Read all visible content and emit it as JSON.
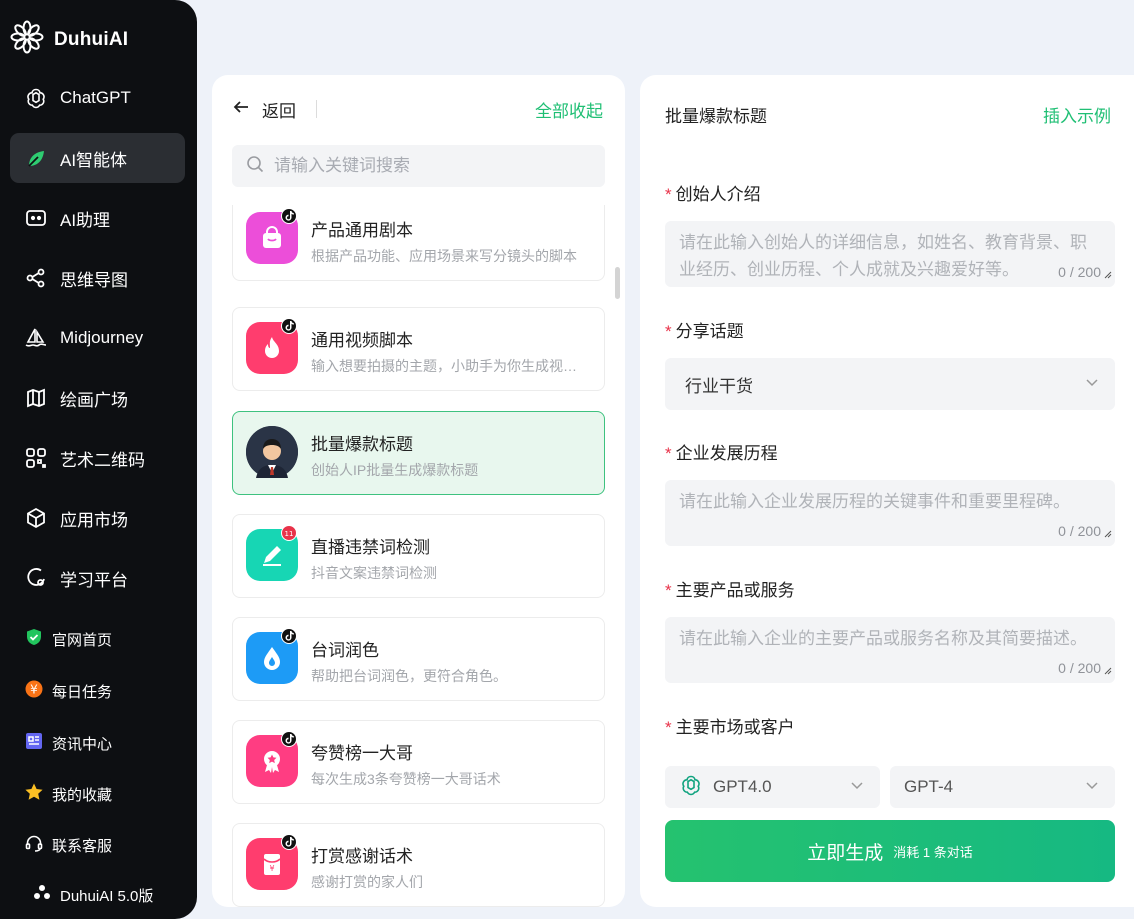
{
  "brand": {
    "name": "DuhuiAI"
  },
  "nav": [
    {
      "label": "ChatGPT",
      "icon": "openai-icon"
    },
    {
      "label": "AI智能体",
      "icon": "leaf-agent-icon",
      "active": true
    },
    {
      "label": "AI助理",
      "icon": "robot-face-icon"
    },
    {
      "label": "思维导图",
      "icon": "mindmap-icon"
    },
    {
      "label": "Midjourney",
      "icon": "sailboat-icon"
    },
    {
      "label": "绘画广场",
      "icon": "map-book-icon"
    },
    {
      "label": "艺术二维码",
      "icon": "qrcode-icon"
    },
    {
      "label": "应用市场",
      "icon": "cube-icon"
    },
    {
      "label": "学习平台",
      "icon": "learning-icon"
    }
  ],
  "subnav": [
    {
      "label": "官网首页",
      "icon": "shield-check-icon"
    },
    {
      "label": "每日任务",
      "icon": "coin-task-icon"
    },
    {
      "label": "资讯中心",
      "icon": "news-icon"
    },
    {
      "label": "我的收藏",
      "icon": "star-icon"
    },
    {
      "label": "联系客服",
      "icon": "headset-icon"
    }
  ],
  "version": "DuhuiAI 5.0版",
  "middle": {
    "back_label": "返回",
    "collapse_label": "全部收起",
    "search_placeholder": "请输入关键词搜索",
    "cards": [
      {
        "title": "产品通用剧本",
        "desc": "根据产品功能、应用场景来写分镜头的脚本",
        "color": "#ec4ed9",
        "icon": "shopping-bag-icon",
        "badge": "tiktok"
      },
      {
        "title": "通用视频脚本",
        "desc": "输入想要拍摄的主题，小助手为你生成视频脚本",
        "color": "#ff3d6e",
        "icon": "fire-icon",
        "badge": "tiktok"
      },
      {
        "title": "批量爆款标题",
        "desc": "创始人IP批量生成爆款标题",
        "color": "#2a3446",
        "icon": "founder-avatar-icon",
        "badge": "",
        "active": true
      },
      {
        "title": "直播违禁词检测",
        "desc": "抖音文案违禁词检测",
        "color": "#17d6b4",
        "icon": "pencil-icon",
        "badge": "red"
      },
      {
        "title": "台词润色",
        "desc": "帮助把台词润色，更符合角色。",
        "color": "#1d9bf6",
        "icon": "water-drop-icon",
        "badge": "tiktok"
      },
      {
        "title": "夸赞榜一大哥",
        "desc": "每次生成3条夸赞榜一大哥话术",
        "color": "#ff3d82",
        "icon": "award-icon",
        "badge": "tiktok"
      },
      {
        "title": "打赏感谢话术",
        "desc": "感谢打赏的家人们",
        "color": "#ff3d6e",
        "icon": "red-envelope-icon",
        "badge": "tiktok"
      }
    ]
  },
  "form": {
    "title": "批量爆款标题",
    "example_label": "插入示例",
    "fields": {
      "founder": {
        "label": "创始人介绍",
        "placeholder": "请在此输入创始人的详细信息，如姓名、教育背景、职业经历、创业历程、个人成就及兴趣爱好等。",
        "count": "0 / 200"
      },
      "topic": {
        "label": "分享话题",
        "value": "行业干货"
      },
      "history": {
        "label": "企业发展历程",
        "placeholder": "请在此输入企业发展历程的关键事件和重要里程碑。",
        "count": "0 / 200"
      },
      "products": {
        "label": "主要产品或服务",
        "placeholder": "请在此输入企业的主要产品或服务名称及其简要描述。",
        "count": "0 / 200"
      },
      "market": {
        "label": "主要市场或客户"
      }
    },
    "model_left": "GPT4.0",
    "model_right": "GPT-4",
    "generate_label": "立即生成",
    "generate_sub": "消耗 1 条对话"
  },
  "colors": {
    "accent": "#1fbf74",
    "required": "#e8334a",
    "sidebar_bg": "#0d0f12"
  }
}
